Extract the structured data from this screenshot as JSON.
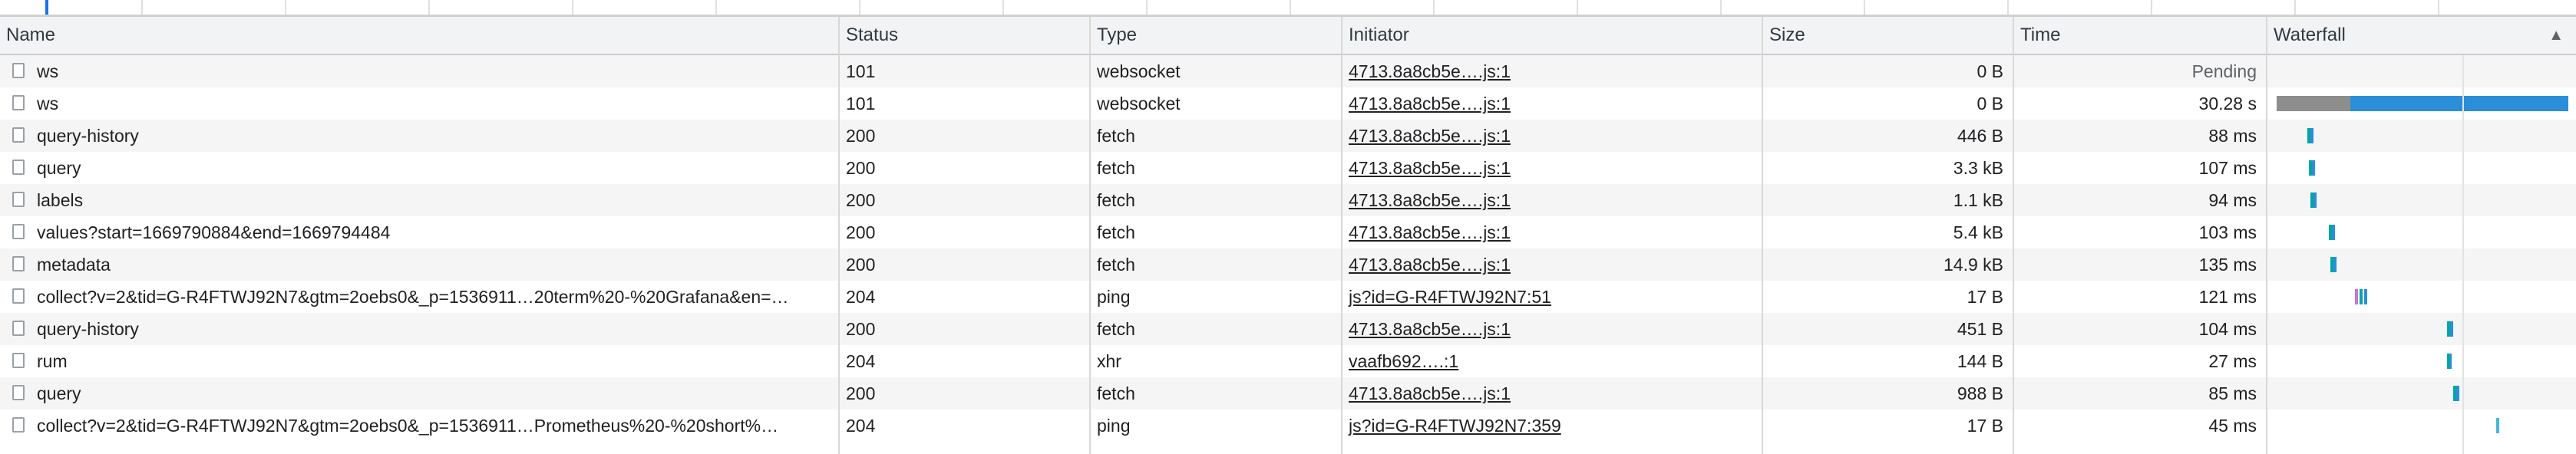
{
  "columns": {
    "name": "Name",
    "status": "Status",
    "type": "Type",
    "initiator": "Initiator",
    "size": "Size",
    "time": "Time",
    "waterfall": "Waterfall"
  },
  "sort_indicator": "▲",
  "requests": [
    {
      "name": "ws",
      "status": "101",
      "type": "websocket",
      "initiator": "4713.8a8cb5e….js:1",
      "size": "0 B",
      "time": "Pending"
    },
    {
      "name": "ws",
      "status": "101",
      "type": "websocket",
      "initiator": "4713.8a8cb5e….js:1",
      "size": "0 B",
      "time": "30.28 s"
    },
    {
      "name": "query-history",
      "status": "200",
      "type": "fetch",
      "initiator": "4713.8a8cb5e….js:1",
      "size": "446 B",
      "time": "88 ms"
    },
    {
      "name": "query",
      "status": "200",
      "type": "fetch",
      "initiator": "4713.8a8cb5e….js:1",
      "size": "3.3 kB",
      "time": "107 ms"
    },
    {
      "name": "labels",
      "status": "200",
      "type": "fetch",
      "initiator": "4713.8a8cb5e….js:1",
      "size": "1.1 kB",
      "time": "94 ms"
    },
    {
      "name": "values?start=1669790884&end=1669794484",
      "status": "200",
      "type": "fetch",
      "initiator": "4713.8a8cb5e….js:1",
      "size": "5.4 kB",
      "time": "103 ms"
    },
    {
      "name": "metadata",
      "status": "200",
      "type": "fetch",
      "initiator": "4713.8a8cb5e….js:1",
      "size": "14.9 kB",
      "time": "135 ms"
    },
    {
      "name": "collect?v=2&tid=G-R4FTWJ92N7&gtm=2oebs0&_p=1536911…20term%20-%20Grafana&en=…",
      "status": "204",
      "type": "ping",
      "initiator": "js?id=G-R4FTWJ92N7:51",
      "size": "17 B",
      "time": "121 ms"
    },
    {
      "name": "query-history",
      "status": "200",
      "type": "fetch",
      "initiator": "4713.8a8cb5e….js:1",
      "size": "451 B",
      "time": "104 ms"
    },
    {
      "name": "rum",
      "status": "204",
      "type": "xhr",
      "initiator": "vaafb692….:1",
      "size": "144 B",
      "time": "27 ms"
    },
    {
      "name": "query",
      "status": "200",
      "type": "fetch",
      "initiator": "4713.8a8cb5e….js:1",
      "size": "988 B",
      "time": "85 ms"
    },
    {
      "name": "collect?v=2&tid=G-R4FTWJ92N7&gtm=2oebs0&_p=1536911…Prometheus%20-%20short%…",
      "status": "204",
      "type": "ping",
      "initiator": "js?id=G-R4FTWJ92N7:359",
      "size": "17 B",
      "time": "45 ms"
    }
  ],
  "waterfall_colors": {
    "connecting": "#8d8d8d",
    "waiting": "#00a6a6",
    "download": "#2b8ed8",
    "queued": "#c874d6",
    "waiting_bright": "#43b8dd"
  }
}
